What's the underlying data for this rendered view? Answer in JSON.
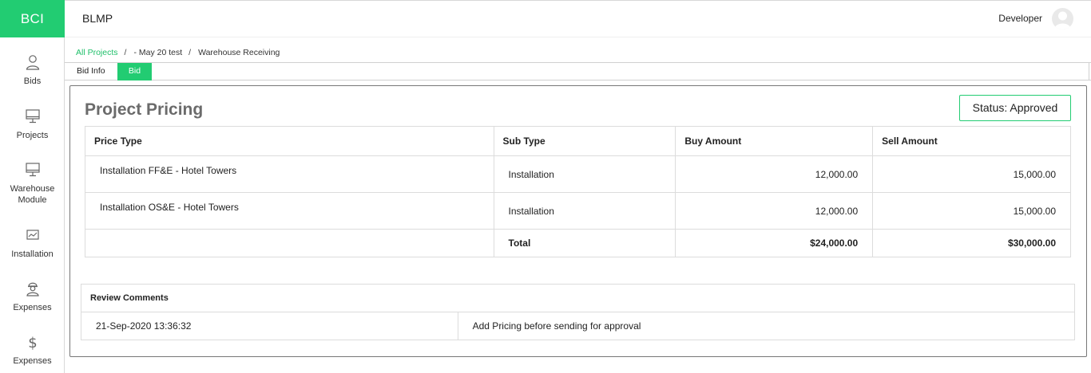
{
  "app": {
    "logo": "BCI",
    "title": "BLMP",
    "user": "Developer"
  },
  "sidebar": {
    "items": [
      {
        "label": "Bids",
        "icon": "user-icon"
      },
      {
        "label": "Projects",
        "icon": "monitor-icon"
      },
      {
        "label": "Warehouse Module",
        "icon": "monitor-icon"
      },
      {
        "label": "Installation",
        "icon": "chart-icon"
      },
      {
        "label": "Expenses",
        "icon": "worker-icon"
      },
      {
        "label": "Expenses",
        "icon": "dollar-icon"
      }
    ]
  },
  "breadcrumb": {
    "root": "All Projects",
    "project": "- May 20 test",
    "current": "Warehouse Receiving"
  },
  "tabs": [
    {
      "label": "Bid Info",
      "active": false
    },
    {
      "label": "Bid",
      "active": true
    }
  ],
  "pricing": {
    "title": "Project Pricing",
    "status": "Status: Approved",
    "columns": [
      "Price Type",
      "Sub Type",
      "Buy Amount",
      "Sell Amount"
    ],
    "rows": [
      {
        "price_type": "Installation FF&E - Hotel Towers",
        "sub_type": "Installation",
        "buy": "12,000.00",
        "sell": "15,000.00"
      },
      {
        "price_type": "Installation OS&E - Hotel Towers",
        "sub_type": "Installation",
        "buy": "12,000.00",
        "sell": "15,000.00"
      }
    ],
    "total": {
      "label": "Total",
      "buy": "$24,000.00",
      "sell": "$30,000.00"
    }
  },
  "review": {
    "header": "Review Comments",
    "rows": [
      {
        "timestamp": "21-Sep-2020 13:36:32",
        "comment": "Add Pricing before sending for approval"
      }
    ]
  },
  "colors": {
    "accent": "#22cc72",
    "link": "#1fbf6a",
    "title_gray": "#6b6b6b"
  }
}
